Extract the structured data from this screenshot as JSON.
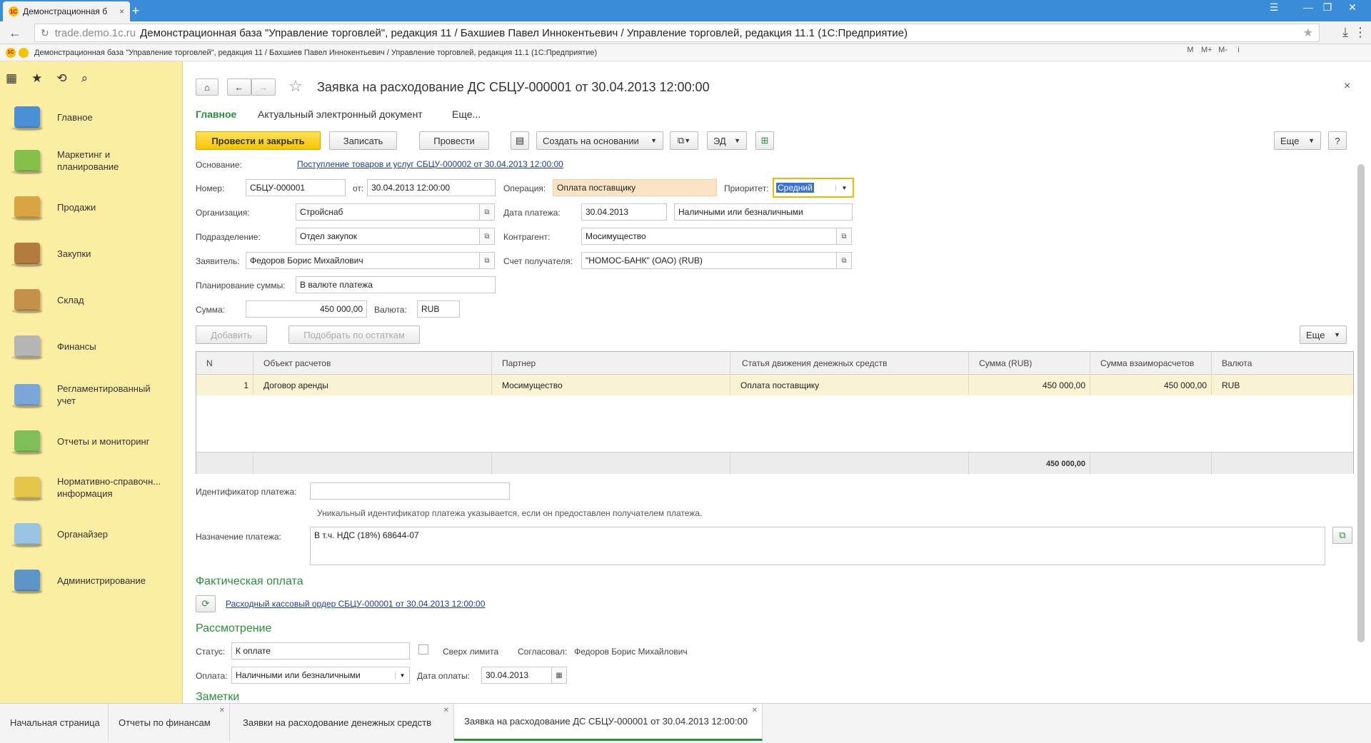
{
  "browser": {
    "tab_title": "Демонстрационная б",
    "tab_logo": "1С",
    "tab_close": "×",
    "new_tab": "+",
    "window_buttons": [
      "☰",
      "—",
      "❐",
      "✕"
    ],
    "back": "←",
    "address_host": "trade.demo.1c.ru",
    "address_title": "Демонстрационная база \"Управление торговлей\", редакция 11 / Бахшиев Павел Иннокентьевич / Управление торговлей, редакция 11.1 (1С:Предприятие)",
    "bookmark_star": "★",
    "download_icon": "⤓",
    "menu_icon": "⋮"
  },
  "app": {
    "logo": "1С",
    "title": "Демонстрационная база \"Управление торговлей\", редакция 11 / Бахшиев Павел Иннокентьевич / Управление торговлей, редакция 11.1 (1С:Предприятие)",
    "tools": [
      "M",
      "M+",
      "M-",
      "i"
    ]
  },
  "sidebar": {
    "tools": [
      "▦",
      "★",
      "⟲",
      "⌕"
    ],
    "sections": [
      {
        "label": "Главное",
        "icon": "main-icon",
        "color": "#4a8fd6"
      },
      {
        "label": "Маркетинг и планирование",
        "icon": "marketing-icon",
        "color": "#86c04a"
      },
      {
        "label": "Продажи",
        "icon": "sales-icon",
        "color": "#d9a441"
      },
      {
        "label": "Закупки",
        "icon": "purchases-icon",
        "color": "#b37b3d"
      },
      {
        "label": "Склад",
        "icon": "warehouse-icon",
        "color": "#c4914a"
      },
      {
        "label": "Финансы",
        "icon": "finance-icon",
        "color": "#b5b5b5"
      },
      {
        "label": "Регламентированный учет",
        "icon": "accounting-icon",
        "color": "#7aa7d8"
      },
      {
        "label": "Отчеты и мониторинг",
        "icon": "reports-icon",
        "color": "#7fbf5a"
      },
      {
        "label": "Нормативно-справочн... информация",
        "icon": "reference-icon",
        "color": "#e3c64a"
      },
      {
        "label": "Органайзер",
        "icon": "organizer-icon",
        "color": "#9ac4e3"
      },
      {
        "label": "Администрирование",
        "icon": "admin-icon",
        "color": "#5d95c9"
      }
    ]
  },
  "document": {
    "title": "Заявка на расходование ДС СБЦУ-000001 от 30.04.2013 12:00:00",
    "close": "×",
    "nav": {
      "home": "⌂",
      "back": "←",
      "forward": "→",
      "favorite": "☆"
    },
    "tabs": [
      "Главное",
      "Актуальный электронный документ",
      "Еще..."
    ],
    "toolbar": {
      "post_close": "Провести и закрыть",
      "save": "Записать",
      "post": "Провести",
      "create_based": "Создать на основании",
      "ed": "ЭД",
      "more": "Еще",
      "help": "?"
    },
    "fields": {
      "basis_label": "Основание:",
      "basis_link": "Поступление товаров и услуг СБЦУ-000002 от 30.04.2013 12:00:00",
      "number_label": "Номер:",
      "number": "СБЦУ-000001",
      "date_label": "от:",
      "date": "30.04.2013 12:00:00",
      "operation_label": "Операция:",
      "operation": "Оплата поставщику",
      "priority_label": "Приоритет:",
      "priority": "Средний",
      "org_label": "Организация:",
      "org": "Стройснаб",
      "pay_date_label": "Дата платежа:",
      "pay_date": "30.04.2013",
      "pay_form": "Наличными или безналичными",
      "dept_label": "Подразделение:",
      "dept": "Отдел закупок",
      "counterparty_label": "Контрагент:",
      "counterparty": "Мосимущество",
      "applicant_label": "Заявитель:",
      "applicant": "Федоров Борис Михайлович",
      "account_label": "Счет получателя:",
      "account": "\"НОМОС-БАНК\" (ОАО) (RUB)",
      "planning_label": "Планирование суммы:",
      "planning": "В валюте платежа",
      "sum_label": "Сумма:",
      "sum": "450 000,00",
      "currency_label": "Валюта:",
      "currency": "RUB"
    },
    "table_toolbar": {
      "add": "Добавить",
      "pick": "Подобрать по остаткам",
      "more": "Еще"
    },
    "table": {
      "columns": [
        "N",
        "Объект расчетов",
        "Партнер",
        "Статья движения денежных средств",
        "Сумма (RUB)",
        "Сумма взаиморасчетов",
        "Валюта"
      ],
      "rows": [
        [
          "1",
          "Договор аренды",
          "Мосимущество",
          "Оплата поставщику",
          "450 000,00",
          "450 000,00",
          "RUB"
        ]
      ],
      "total": "450 000,00"
    },
    "payment_id_label": "Идентификатор платежа:",
    "payment_id": "",
    "payment_id_hint": "Уникальный идентификатор платежа указывается, если он предоставлен получателем платежа.",
    "purpose_label": "Назначение платежа:",
    "purpose": "В т.ч. НДС (18%) 68644-07",
    "actual_title": "Фактическая оплата",
    "actual_link": "Расходный кассовый ордер СБЦУ-000001 от 30.04.2013 12:00:00",
    "review_title": "Рассмотрение",
    "status_label": "Статус:",
    "status": "К оплате",
    "over_limit_label": "Сверх лимита",
    "approved_label": "Согласовал:",
    "approved_by": "Федоров Борис Михайлович",
    "payment_label": "Оплата:",
    "payment": "Наличными или безналичными",
    "payment_date_label": "Дата оплаты:",
    "payment_date": "30.04.2013",
    "notes_title": "Заметки"
  },
  "bottom_tabs": [
    {
      "label": "Начальная страница",
      "closable": false
    },
    {
      "label": "Отчеты по финансам",
      "closable": true
    },
    {
      "label": "Заявки на расходование денежных средств",
      "closable": true
    },
    {
      "label": "Заявка на расходование ДС СБЦУ-000001 от 30.04.2013 12:00:00",
      "closable": true,
      "active": true
    }
  ],
  "colors": {
    "accent_green": "#2a8e3d",
    "sidebar": "#fbeda2",
    "browser_blue": "#3a8bd8",
    "primary_button": "#f6c400",
    "link": "#1c3e94"
  }
}
